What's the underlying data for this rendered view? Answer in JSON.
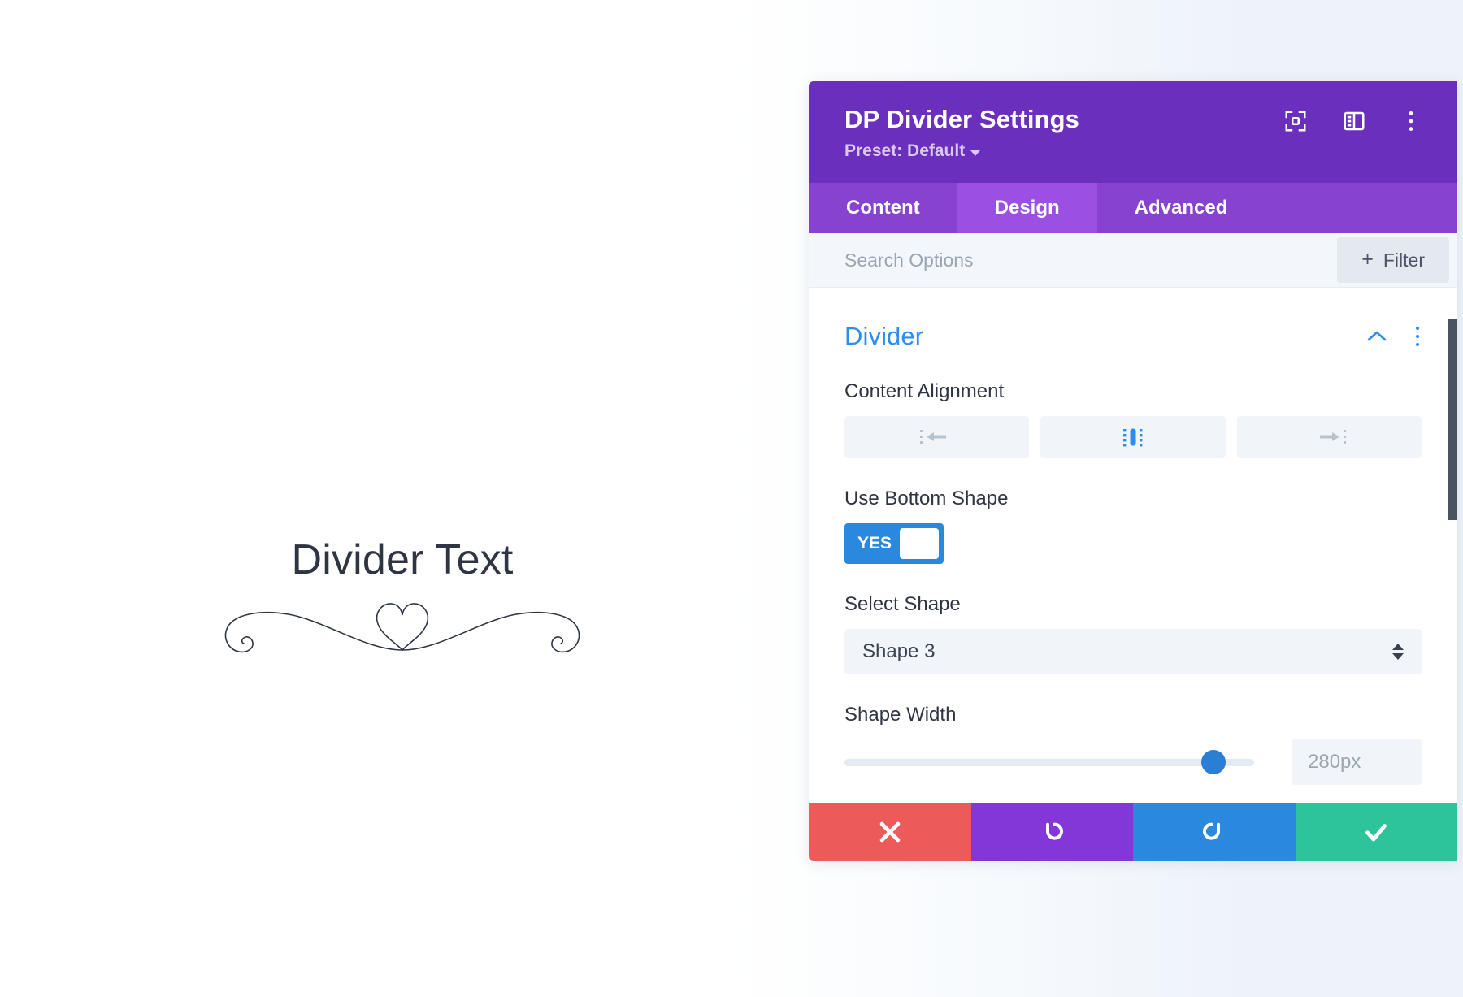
{
  "canvas": {
    "divider_text": "Divider Text",
    "ornament_name": "heart-flourish-shape-3"
  },
  "modal": {
    "title": "DP Divider Settings",
    "preset_label": "Preset: Default",
    "header_icons": [
      {
        "name": "focus-target-icon"
      },
      {
        "name": "panel-layout-icon"
      },
      {
        "name": "more-vertical-icon"
      }
    ],
    "tabs": [
      {
        "label": "Content",
        "active": false
      },
      {
        "label": "Design",
        "active": true
      },
      {
        "label": "Advanced",
        "active": false
      }
    ],
    "search": {
      "placeholder": "Search Options",
      "value": ""
    },
    "filter_button": {
      "label": "Filter",
      "plus": "+"
    },
    "section": {
      "title": "Divider",
      "collapse_icon": "chevron-up-icon",
      "menu_icon": "more-vertical-icon"
    },
    "fields": {
      "content_alignment": {
        "label": "Content Alignment",
        "options": [
          {
            "name": "align-left",
            "selected": false
          },
          {
            "name": "align-center",
            "selected": true
          },
          {
            "name": "align-right",
            "selected": false
          }
        ]
      },
      "use_bottom_shape": {
        "label": "Use Bottom Shape",
        "toggle_state": "YES"
      },
      "select_shape": {
        "label": "Select Shape",
        "value": "Shape 3"
      },
      "shape_width": {
        "label": "Shape Width",
        "value": "280px",
        "slider_percent": 90
      }
    },
    "footer": [
      {
        "name": "cancel-button",
        "icon": "close-icon"
      },
      {
        "name": "undo-button",
        "icon": "undo-icon"
      },
      {
        "name": "redo-button",
        "icon": "redo-icon"
      },
      {
        "name": "save-button",
        "icon": "check-icon"
      }
    ]
  },
  "colors": {
    "header_purple": "#6b2fbd",
    "tab_purple": "#8742cf",
    "tab_active_purple": "#9b4fe3",
    "accent_blue": "#2d8cf0",
    "toggle_blue": "#2a89dc",
    "cancel_red": "#ec5a5a",
    "undo_purple": "#8437d8",
    "redo_blue": "#2a89dc",
    "save_green": "#2ec49b"
  }
}
